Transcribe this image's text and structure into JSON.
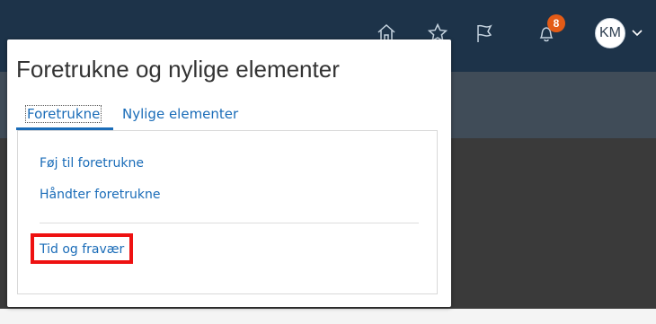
{
  "header": {
    "notification_count": "8",
    "avatar_initials": "KM",
    "icons": [
      "home-icon",
      "star-icon",
      "flag-icon",
      "bell-icon",
      "chevron-down-icon"
    ]
  },
  "popup": {
    "title": "Foretrukne og nylige elementer",
    "tabs": [
      {
        "label": "Foretrukne",
        "active": true
      },
      {
        "label": "Nylige elementer",
        "active": false
      }
    ],
    "actions": [
      {
        "label": "Føj til foretrukne"
      },
      {
        "label": "Håndter foretrukne"
      }
    ],
    "favorites": [
      {
        "label": "Tid og fravær",
        "highlighted": true
      }
    ]
  },
  "colors": {
    "topbar": "#1d3349",
    "link": "#1a6cb8",
    "badge": "#e35b16",
    "highlight": "#ee1111"
  }
}
